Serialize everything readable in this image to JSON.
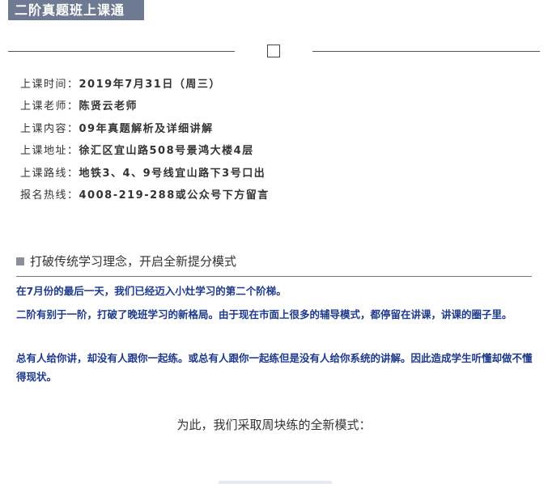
{
  "header": {
    "title": "二阶真题班上课通"
  },
  "divider": {
    "icon": "square-outline-icon"
  },
  "info": [
    {
      "label": "上课时间：",
      "value": "2019年7月31日（周三）"
    },
    {
      "label": "上课老师：",
      "value": "陈贤云老师"
    },
    {
      "label": "上课内容：",
      "value": "09年真题解析及详细讲解"
    },
    {
      "label": "上课地址：",
      "value": "徐汇区宜山路508号景鸿大楼4层"
    },
    {
      "label": "上课路线：",
      "value": "地铁3、4、9号线宜山路下3号口出"
    },
    {
      "label": "报名热线：",
      "value": "4008-219-288或公众号下方留言"
    }
  ],
  "section": {
    "title": "打破传统学习理念，开启全新提分模式"
  },
  "paragraphs": [
    "在7月份的最后一天，我们已经迈入小灶学习的第二个阶梯。",
    "二阶有别于一阶，打破了晚班学习的新格局。由于现在市面上很多的辅导模式，都停留在讲课，讲课的圈子里。",
    "总有人给你讲，却没有人跟你一起练。或总有人跟你一起练但是没有人给你系统的讲解。因此造成学生听懂却做不懂得现状。"
  ],
  "closing": "为此，我们采取周块练的全新模式："
}
